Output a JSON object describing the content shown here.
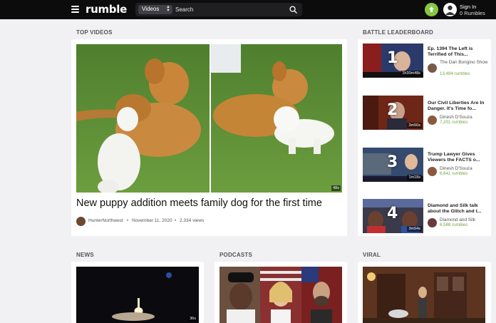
{
  "header": {
    "logo": "rumble",
    "category": "Videos",
    "search_placeholder": "Search",
    "signin_label": "Sign In",
    "rumbles": "0 Rumbles"
  },
  "sections": {
    "top_videos": "TOP VIDEOS",
    "leaderboard": "BATTLE LEADERBOARD",
    "news": "NEWS",
    "podcasts": "PODCASTS",
    "viral": "VIRAL"
  },
  "featured": {
    "title": "New puppy addition meets family dog for the first time",
    "channel": "HunterNorthwest",
    "date": "November 11, 2020",
    "views": "2,334 views",
    "duration": "48s"
  },
  "leaderboard": [
    {
      "rank": "1",
      "title": "Ep. 1394 The Left is Terrified of This...",
      "channel": "The Dan Bongino Show",
      "rumbles": "13,494 rumbles",
      "duration": "1h30m48s"
    },
    {
      "rank": "2",
      "title": "Our Civil Liberties Are In Danger. It's Time fo...",
      "channel": "Dinesh D'Souza",
      "rumbles": "7,201 rumbles",
      "duration": "3m50s"
    },
    {
      "rank": "3",
      "title": "Trump Lawyer Gives Viewers the FACTS o...",
      "channel": "Dinesh D'Souza",
      "rumbles": "6,641 rumbles",
      "duration": "1m18s"
    },
    {
      "rank": "4",
      "title": "Diamond and Silk talk about the Glitch and t...",
      "channel": "Diamond and Silk",
      "rumbles": "6,588 rumbles",
      "duration": "3m54s"
    }
  ],
  "news": {
    "duration": "36s"
  },
  "colors": {
    "accent": "#85c742",
    "rumbles_green": "#74a53c",
    "header_bg": "#0c0c0d"
  }
}
